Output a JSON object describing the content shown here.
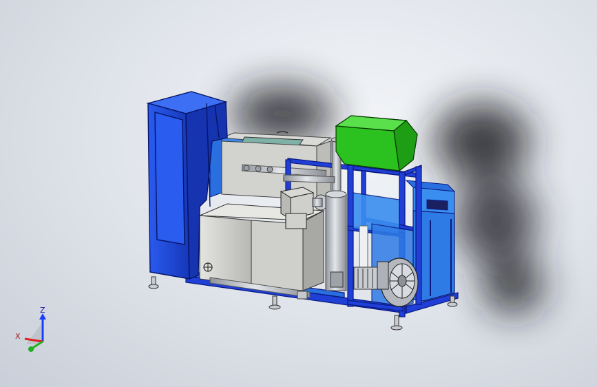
{
  "viewport": {
    "background_inner": "#f3f5f8",
    "background_outer": "#c9cfd8"
  },
  "model": {
    "colors": {
      "frame_blue": "#1f3fd6",
      "panel_blue": "#2a6fe0",
      "cabinet_blue": "#1e4fd8",
      "green_hood": "#2bc21f",
      "grey_tank": "#c9c9c6",
      "pipe_grey": "#b9bcc2"
    }
  },
  "triad": {
    "z_label": "Z",
    "x_label": "X",
    "z_color": "#1a3cff",
    "x_color": "#e02020",
    "y_color": "#22b022"
  }
}
